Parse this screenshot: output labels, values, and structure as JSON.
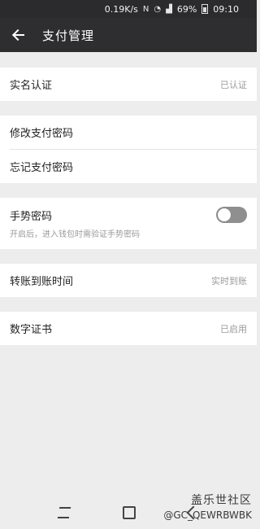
{
  "status_bar": {
    "speed": "0.19K/s",
    "battery": "69%",
    "time": "09:10"
  },
  "header": {
    "title": "支付管理"
  },
  "groups": {
    "realname": {
      "label": "实名认证",
      "value": "已认证"
    },
    "password": {
      "change": "修改支付密码",
      "forgot": "忘记支付密码"
    },
    "gesture": {
      "label": "手势密码",
      "description": "开启后，进入钱包时需验证手势密码",
      "enabled": false
    },
    "transfer": {
      "label": "转账到账时间",
      "value": "实时到账"
    },
    "certificate": {
      "label": "数字证书",
      "value": "已启用"
    }
  },
  "watermark": {
    "line1": "盖乐世社区",
    "line2": "@GC_QEWRBWBK"
  }
}
